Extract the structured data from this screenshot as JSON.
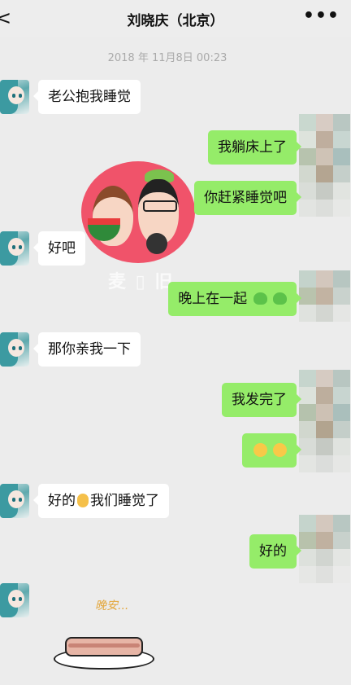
{
  "header": {
    "back_icon": "chevron-left-icon",
    "title": "刘晓庆（北京）",
    "more_icon": "ellipsis-icon",
    "more_label": "•••"
  },
  "timestamp": "2018 年 11月8日 00:23",
  "messages": [
    {
      "side": "left",
      "text": "老公抱我睡觉"
    },
    {
      "side": "right",
      "text": "我躺床上了"
    },
    {
      "side": "right",
      "text": "你赶紧睡觉吧"
    },
    {
      "side": "left",
      "text": "好吧"
    },
    {
      "side": "right",
      "text": "晚上在一起"
    },
    {
      "side": "left",
      "text": "那你亲我一下"
    },
    {
      "side": "right",
      "text": "我发完了"
    },
    {
      "side": "right",
      "text": ""
    },
    {
      "side": "left",
      "text": "好的",
      "text_after": "我们睡觉了"
    },
    {
      "side": "right",
      "text": "好的"
    }
  ],
  "sticker_caption": "晚安...",
  "colors": {
    "background": "#ececec",
    "bubble_self": "#95ec69",
    "bubble_other": "#ffffff"
  }
}
